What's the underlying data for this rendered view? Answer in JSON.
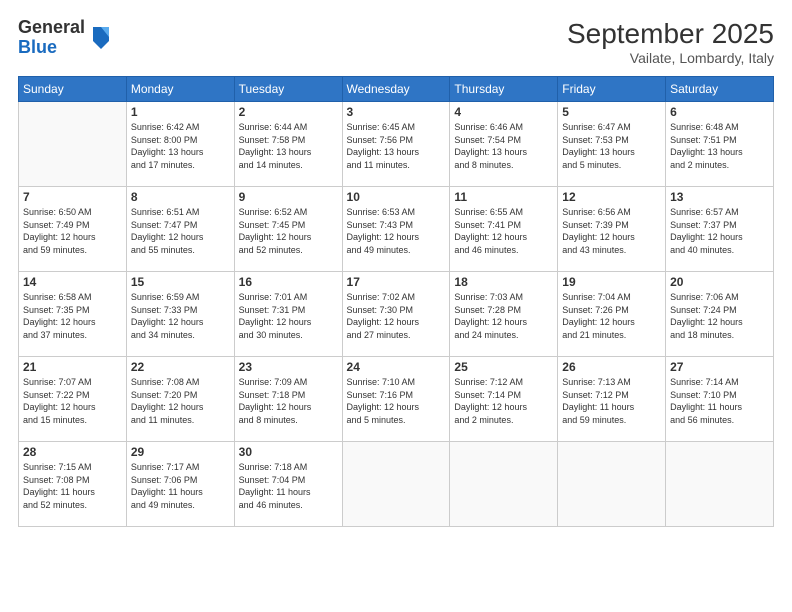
{
  "logo": {
    "general": "General",
    "blue": "Blue"
  },
  "title": {
    "month": "September 2025",
    "location": "Vailate, Lombardy, Italy"
  },
  "weekdays": [
    "Sunday",
    "Monday",
    "Tuesday",
    "Wednesday",
    "Thursday",
    "Friday",
    "Saturday"
  ],
  "weeks": [
    [
      {
        "num": "",
        "info": ""
      },
      {
        "num": "1",
        "info": "Sunrise: 6:42 AM\nSunset: 8:00 PM\nDaylight: 13 hours\nand 17 minutes."
      },
      {
        "num": "2",
        "info": "Sunrise: 6:44 AM\nSunset: 7:58 PM\nDaylight: 13 hours\nand 14 minutes."
      },
      {
        "num": "3",
        "info": "Sunrise: 6:45 AM\nSunset: 7:56 PM\nDaylight: 13 hours\nand 11 minutes."
      },
      {
        "num": "4",
        "info": "Sunrise: 6:46 AM\nSunset: 7:54 PM\nDaylight: 13 hours\nand 8 minutes."
      },
      {
        "num": "5",
        "info": "Sunrise: 6:47 AM\nSunset: 7:53 PM\nDaylight: 13 hours\nand 5 minutes."
      },
      {
        "num": "6",
        "info": "Sunrise: 6:48 AM\nSunset: 7:51 PM\nDaylight: 13 hours\nand 2 minutes."
      }
    ],
    [
      {
        "num": "7",
        "info": "Sunrise: 6:50 AM\nSunset: 7:49 PM\nDaylight: 12 hours\nand 59 minutes."
      },
      {
        "num": "8",
        "info": "Sunrise: 6:51 AM\nSunset: 7:47 PM\nDaylight: 12 hours\nand 55 minutes."
      },
      {
        "num": "9",
        "info": "Sunrise: 6:52 AM\nSunset: 7:45 PM\nDaylight: 12 hours\nand 52 minutes."
      },
      {
        "num": "10",
        "info": "Sunrise: 6:53 AM\nSunset: 7:43 PM\nDaylight: 12 hours\nand 49 minutes."
      },
      {
        "num": "11",
        "info": "Sunrise: 6:55 AM\nSunset: 7:41 PM\nDaylight: 12 hours\nand 46 minutes."
      },
      {
        "num": "12",
        "info": "Sunrise: 6:56 AM\nSunset: 7:39 PM\nDaylight: 12 hours\nand 43 minutes."
      },
      {
        "num": "13",
        "info": "Sunrise: 6:57 AM\nSunset: 7:37 PM\nDaylight: 12 hours\nand 40 minutes."
      }
    ],
    [
      {
        "num": "14",
        "info": "Sunrise: 6:58 AM\nSunset: 7:35 PM\nDaylight: 12 hours\nand 37 minutes."
      },
      {
        "num": "15",
        "info": "Sunrise: 6:59 AM\nSunset: 7:33 PM\nDaylight: 12 hours\nand 34 minutes."
      },
      {
        "num": "16",
        "info": "Sunrise: 7:01 AM\nSunset: 7:31 PM\nDaylight: 12 hours\nand 30 minutes."
      },
      {
        "num": "17",
        "info": "Sunrise: 7:02 AM\nSunset: 7:30 PM\nDaylight: 12 hours\nand 27 minutes."
      },
      {
        "num": "18",
        "info": "Sunrise: 7:03 AM\nSunset: 7:28 PM\nDaylight: 12 hours\nand 24 minutes."
      },
      {
        "num": "19",
        "info": "Sunrise: 7:04 AM\nSunset: 7:26 PM\nDaylight: 12 hours\nand 21 minutes."
      },
      {
        "num": "20",
        "info": "Sunrise: 7:06 AM\nSunset: 7:24 PM\nDaylight: 12 hours\nand 18 minutes."
      }
    ],
    [
      {
        "num": "21",
        "info": "Sunrise: 7:07 AM\nSunset: 7:22 PM\nDaylight: 12 hours\nand 15 minutes."
      },
      {
        "num": "22",
        "info": "Sunrise: 7:08 AM\nSunset: 7:20 PM\nDaylight: 12 hours\nand 11 minutes."
      },
      {
        "num": "23",
        "info": "Sunrise: 7:09 AM\nSunset: 7:18 PM\nDaylight: 12 hours\nand 8 minutes."
      },
      {
        "num": "24",
        "info": "Sunrise: 7:10 AM\nSunset: 7:16 PM\nDaylight: 12 hours\nand 5 minutes."
      },
      {
        "num": "25",
        "info": "Sunrise: 7:12 AM\nSunset: 7:14 PM\nDaylight: 12 hours\nand 2 minutes."
      },
      {
        "num": "26",
        "info": "Sunrise: 7:13 AM\nSunset: 7:12 PM\nDaylight: 11 hours\nand 59 minutes."
      },
      {
        "num": "27",
        "info": "Sunrise: 7:14 AM\nSunset: 7:10 PM\nDaylight: 11 hours\nand 56 minutes."
      }
    ],
    [
      {
        "num": "28",
        "info": "Sunrise: 7:15 AM\nSunset: 7:08 PM\nDaylight: 11 hours\nand 52 minutes."
      },
      {
        "num": "29",
        "info": "Sunrise: 7:17 AM\nSunset: 7:06 PM\nDaylight: 11 hours\nand 49 minutes."
      },
      {
        "num": "30",
        "info": "Sunrise: 7:18 AM\nSunset: 7:04 PM\nDaylight: 11 hours\nand 46 minutes."
      },
      {
        "num": "",
        "info": ""
      },
      {
        "num": "",
        "info": ""
      },
      {
        "num": "",
        "info": ""
      },
      {
        "num": "",
        "info": ""
      }
    ]
  ]
}
